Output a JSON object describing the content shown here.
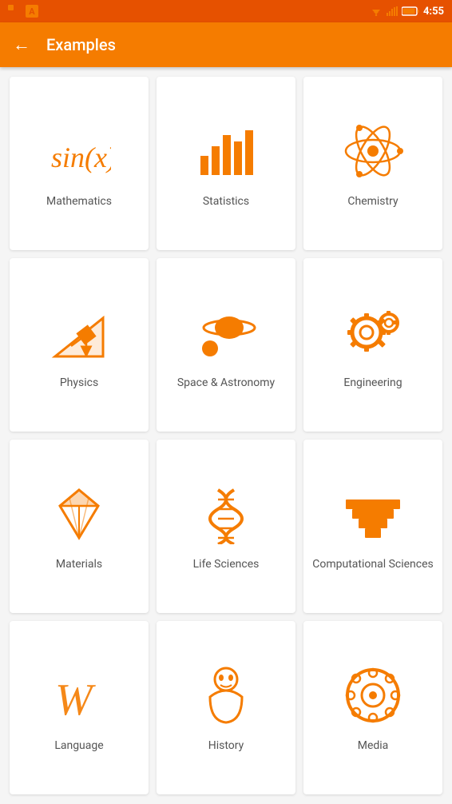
{
  "statusBar": {
    "time": "4:55"
  },
  "header": {
    "title": "Examples",
    "backLabel": "←"
  },
  "cards": [
    {
      "id": "mathematics",
      "label": "Mathematics",
      "icon": "math"
    },
    {
      "id": "statistics",
      "label": "Statistics",
      "icon": "stats"
    },
    {
      "id": "chemistry",
      "label": "Chemistry",
      "icon": "chemistry"
    },
    {
      "id": "physics",
      "label": "Physics",
      "icon": "physics"
    },
    {
      "id": "space-astronomy",
      "label": "Space & Astronomy",
      "icon": "space"
    },
    {
      "id": "engineering",
      "label": "Engineering",
      "icon": "engineering"
    },
    {
      "id": "materials",
      "label": "Materials",
      "icon": "materials"
    },
    {
      "id": "life-sciences",
      "label": "Life Sciences",
      "icon": "dna"
    },
    {
      "id": "computational-sciences",
      "label": "Computational Sciences",
      "icon": "computational"
    },
    {
      "id": "language",
      "label": "Language",
      "icon": "language"
    },
    {
      "id": "history",
      "label": "History",
      "icon": "history"
    },
    {
      "id": "media",
      "label": "Media",
      "icon": "media"
    }
  ],
  "colors": {
    "primary": "#f57c00",
    "statusBar": "#e65100"
  }
}
